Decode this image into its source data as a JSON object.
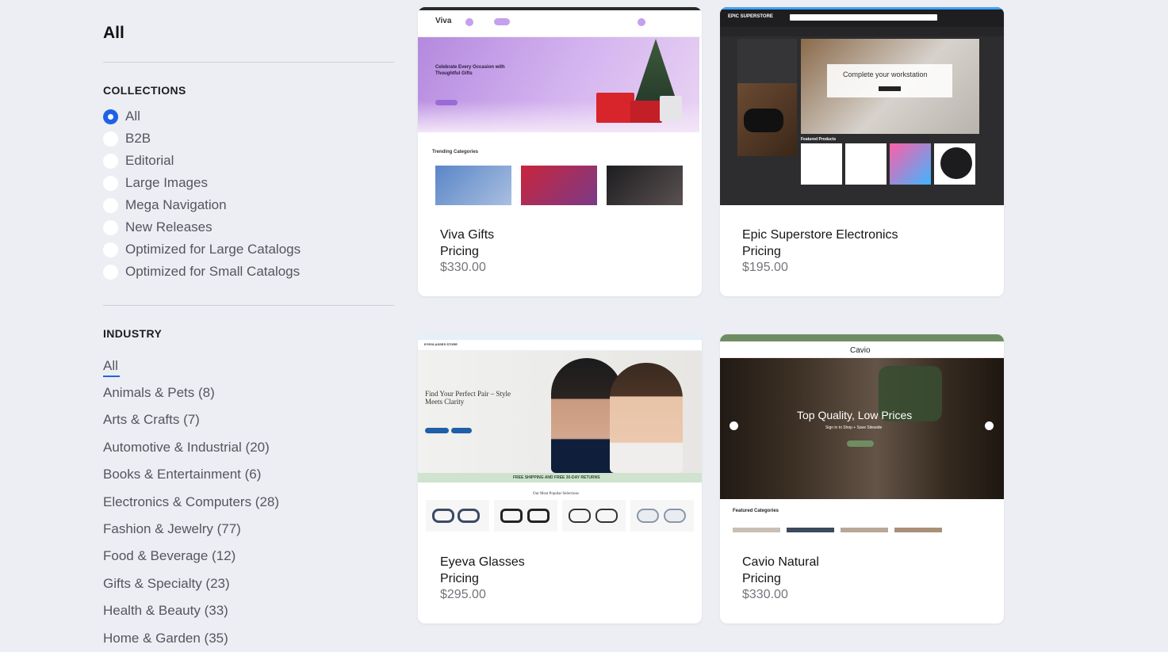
{
  "sidebar": {
    "heading": "All",
    "collections": {
      "title": "COLLECTIONS",
      "items": [
        {
          "label": "All",
          "checked": true
        },
        {
          "label": "B2B"
        },
        {
          "label": "Editorial"
        },
        {
          "label": "Large Images"
        },
        {
          "label": "Mega Navigation"
        },
        {
          "label": "New Releases"
        },
        {
          "label": "Optimized for Large Catalogs"
        },
        {
          "label": "Optimized for Small Catalogs"
        }
      ]
    },
    "industry": {
      "title": "INDUSTRY",
      "items": [
        {
          "label": "All",
          "active": true
        },
        {
          "label": "Animals & Pets (8)"
        },
        {
          "label": "Arts & Crafts (7)"
        },
        {
          "label": "Automotive & Industrial (20)"
        },
        {
          "label": "Books & Entertainment (6)"
        },
        {
          "label": "Electronics & Computers (28)"
        },
        {
          "label": "Fashion & Jewelry (77)"
        },
        {
          "label": "Food & Beverage (12)"
        },
        {
          "label": "Gifts & Specialty (23)"
        },
        {
          "label": "Health & Beauty (33)"
        },
        {
          "label": "Home & Garden (35)"
        }
      ]
    }
  },
  "themes": [
    {
      "name": "Viva Gifts",
      "sub": "Pricing",
      "price": "$330.00",
      "preview": {
        "logo": "Viva",
        "headline": "Celebrate Every Occasion with Thoughtful Gifts",
        "section": "Trending Categories",
        "accent": "#b58be0"
      }
    },
    {
      "name": "Epic Superstore Electronics",
      "sub": "Pricing",
      "price": "$195.00",
      "preview": {
        "logo": "EPIC SUPERSTORE",
        "headline": "Complete your workstation",
        "section": "Featured Products",
        "accent": "#2a2a2c"
      }
    },
    {
      "name": "Eyeva Glasses",
      "sub": "Pricing",
      "price": "$295.00",
      "preview": {
        "logo": "EYEGLASSES STORE",
        "headline": "Find Your Perfect Pair – Style Meets Clarity",
        "banner": "FREE SHIPPING AND FREE 30-DAY RETURNS",
        "section": "Our Most Popular Selections",
        "accent": "#1f5fa8"
      }
    },
    {
      "name": "Cavio Natural",
      "sub": "Pricing",
      "price": "$330.00",
      "preview": {
        "logo": "Cavio",
        "headline": "Top Quality, Low Prices",
        "tagline": "Sign in to Shop + Save Sitewide",
        "section": "Featured Categories",
        "accent": "#6f8d62"
      }
    }
  ]
}
